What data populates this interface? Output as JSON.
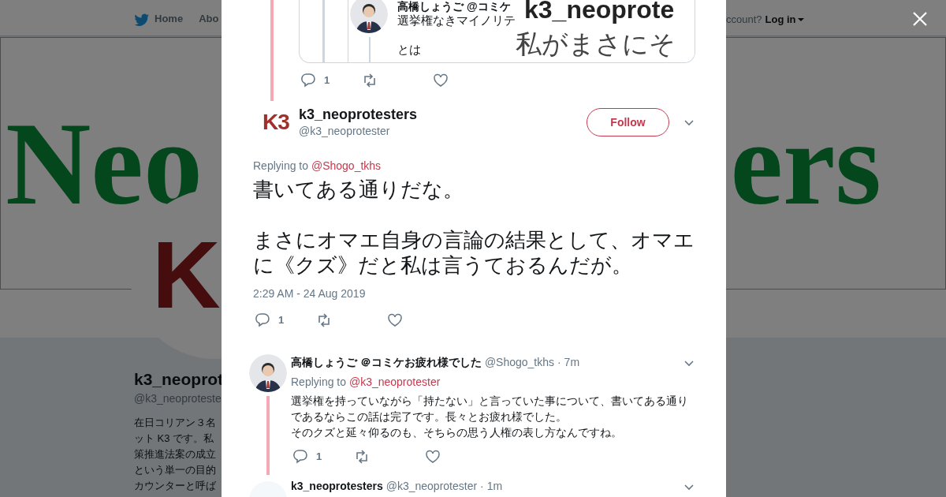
{
  "background_page": {
    "nav": {
      "items": [
        {
          "label": "Home"
        },
        {
          "label": "Abo"
        }
      ],
      "account_prompt": "ccount?",
      "login": "Log in"
    },
    "banner": {
      "texts": [
        "Neo",
        "ers"
      ]
    },
    "avatar_text": "K",
    "profile": {
      "name": "k3_neoprot",
      "handle": "@k3_neoproteste",
      "bio_lines": [
        "在日コリアン３名",
        "ット K3 です。私",
        "策推進法案の成立",
        "という単一の目的",
        "カウンターと呼ば"
      ]
    }
  },
  "top_tweet": {
    "embedded_image": {
      "name_line": "高橋しょうご @コミケ",
      "text_line": "選挙権なきマイノリテ",
      "text_line_2": "とは",
      "big_lines": [
        "k3_neoprote",
        "私がまさにそ"
      ]
    },
    "reply_count": "1"
  },
  "main_tweet": {
    "avatar_text": "K3",
    "name": "k3_neoprotesters",
    "handle": "@k3_neoprotester",
    "follow_label": "Follow",
    "replying_label": "Replying to",
    "replying_to": "@Shogo_tkhs",
    "paragraphs": [
      "書いてある通りだな。",
      "まさにオマエ自身の言論の結果として、オマエに《クズ》だと私は言うておるんだが。"
    ],
    "timestamp": "2:29 AM - 24 Aug 2019",
    "reply_count": "1"
  },
  "replies": [
    {
      "name": "高橋しょうご ＠コミケお疲れ様でした",
      "handle": "@Shogo_tkhs",
      "time": "· 7m",
      "replying_label": "Replying to",
      "replying_to": "@k3_neoprotester",
      "lines": [
        "選挙権を持っていながら「持たない」と言っていた事について、書いてある通りであるならこの話は完了です。長々とお疲れ様でした。",
        "そのクズと延々仰るのも、そちらの思う人権の表し方なんですね。"
      ],
      "reply_count": "1"
    },
    {
      "name": "k3_neoprotesters",
      "handle": "@k3_neoprotester",
      "time": "· 1m"
    }
  ]
}
